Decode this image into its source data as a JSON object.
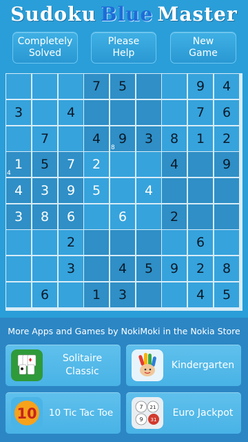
{
  "header": {
    "title_word1": "Sudoku",
    "title_word2": "Blue",
    "title_word3": "Master"
  },
  "buttons": {
    "completely_solved": "Completely\nSolved",
    "please_help": "Please\nHelp",
    "new_game": "New\nGame"
  },
  "board": {
    "rows": [
      [
        "",
        "",
        "",
        "7",
        "5",
        "",
        "",
        "9",
        "4"
      ],
      [
        "3",
        "",
        "4",
        "",
        "",
        "",
        "",
        "7",
        "6"
      ],
      [
        "",
        "7",
        "",
        "4",
        "9",
        "3",
        "8",
        "1",
        "2"
      ],
      [
        "1",
        "5",
        "7",
        "2",
        "",
        "",
        "4",
        "",
        "9"
      ],
      [
        "4",
        "3",
        "9",
        "5",
        "",
        "4",
        "",
        "",
        ""
      ],
      [
        "3",
        "8",
        "6",
        "",
        "6",
        "",
        "2",
        "",
        ""
      ],
      [
        "",
        "",
        "2",
        "",
        "",
        "",
        "",
        "6",
        ""
      ],
      [
        "",
        "",
        "3",
        "",
        "4",
        "5",
        "9",
        "2",
        "8"
      ],
      [
        "",
        "6",
        "",
        "1",
        "3",
        "",
        "",
        "4",
        "5"
      ]
    ],
    "highlighted": [
      [
        1,
        1,
        1,
        0,
        0,
        0,
        1,
        1,
        1
      ],
      [
        1,
        1,
        1,
        0,
        0,
        0,
        1,
        1,
        1
      ],
      [
        1,
        1,
        1,
        0,
        0,
        0,
        1,
        1,
        1
      ],
      [
        0,
        0,
        0,
        1,
        1,
        1,
        0,
        0,
        0
      ],
      [
        0,
        0,
        0,
        1,
        1,
        1,
        0,
        0,
        0
      ],
      [
        0,
        0,
        0,
        1,
        1,
        1,
        0,
        0,
        0
      ],
      [
        1,
        1,
        1,
        0,
        0,
        0,
        1,
        1,
        1
      ],
      [
        1,
        1,
        1,
        0,
        0,
        0,
        1,
        1,
        1
      ],
      [
        1,
        1,
        1,
        0,
        0,
        0,
        1,
        1,
        1
      ]
    ],
    "white_digits": [
      [
        3,
        0
      ],
      [
        4,
        0
      ],
      [
        5,
        0
      ],
      [
        4,
        1
      ],
      [
        5,
        1
      ],
      [
        3,
        2
      ],
      [
        4,
        2
      ],
      [
        5,
        2
      ],
      [
        3,
        3
      ],
      [
        4,
        3
      ],
      [
        5,
        3
      ],
      [
        5,
        4
      ],
      [
        4,
        5
      ],
      [
        6,
        6
      ]
    ],
    "pencil_marks": [
      {
        "row": 2,
        "col": 4,
        "text": "8"
      },
      {
        "row": 3,
        "col": 0,
        "text": "4"
      }
    ],
    "colors": {
      "block_light": "#36a3dc",
      "block_dark": "#2f8fc6",
      "grid_line": "#d7ecf7",
      "digit_dark": "#0a1a2a",
      "digit_white": "#ffffff"
    }
  },
  "promo": {
    "text": "More Apps and Games by NokiMoki in the Nokia Store",
    "apps": [
      {
        "label": "Solitaire\nClassic",
        "icon": "solitaire-cards-icon"
      },
      {
        "label": "Kindergarten",
        "icon": "painted-hand-icon"
      },
      {
        "label": "10 Tic Tac Toe",
        "icon": "tic-tac-toe-10-icon"
      },
      {
        "label": "Euro Jackpot",
        "icon": "lottery-balls-icon"
      }
    ]
  },
  "theme": {
    "background": "#2a9ed8",
    "title_blue": "#1e6dd8"
  }
}
